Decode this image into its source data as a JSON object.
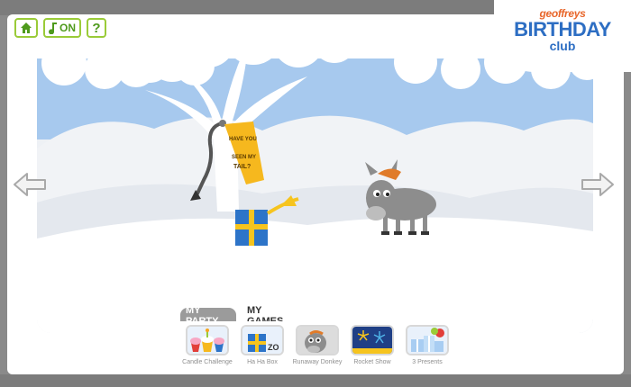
{
  "toolbar": {
    "home_icon": "home-icon",
    "sound_icon": "music-note-icon",
    "sound_label": "ON",
    "help_label": "?"
  },
  "logo": {
    "prefix": "geoffreys",
    "title": "BIRTHDAY",
    "subtitle": "club"
  },
  "scene": {
    "sign_line1": "HAVE YOU",
    "sign_line2": "SEEN MY",
    "sign_line3": "TAIL?"
  },
  "navigation": {
    "prev_icon": "arrow-left-icon",
    "next_icon": "arrow-right-icon"
  },
  "tabs": [
    {
      "label": "MY PARTY",
      "active": false
    },
    {
      "label": "MY GAMES",
      "active": true
    }
  ],
  "games": [
    {
      "label": "Candle Challenge",
      "icon": "cupcakes-icon"
    },
    {
      "label": "Ha Ha Box",
      "icon": "jack-in-box-icon"
    },
    {
      "label": "Runaway Donkey",
      "icon": "donkey-icon"
    },
    {
      "label": "Rocket Show",
      "icon": "fireworks-icon"
    },
    {
      "label": "3 Presents",
      "icon": "presents-icon"
    }
  ],
  "colors": {
    "sky": "#a7c9ee",
    "snow": "#f2f4f7",
    "accent_green": "#9acb38",
    "logo_blue": "#2d6ec3",
    "logo_orange": "#e8662a",
    "sign_yellow": "#f6b81e",
    "gift_blue": "#2d74c8",
    "donkey_grey": "#8d8d8d"
  }
}
